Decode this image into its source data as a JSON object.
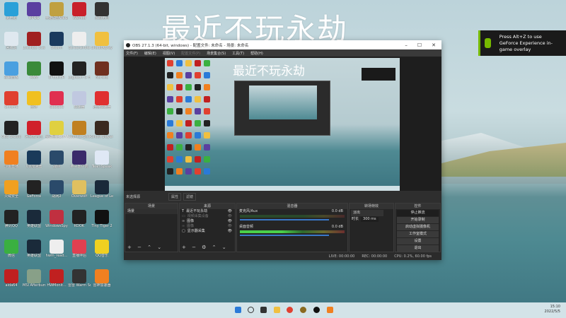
{
  "desktop": {
    "overlay_title": "最近不玩永劫",
    "icons": [
      {
        "label": "此电脑",
        "color": "#2aa0d8"
      },
      {
        "label": "OPGG",
        "color": "#5a3fa0"
      },
      {
        "label": "英雄联盟WeGame",
        "color": "#c0a040"
      },
      {
        "label": "WeMod",
        "color": "#c8202a"
      },
      {
        "label": "永劫无间",
        "color": "#333"
      },
      {
        "label": "回收站",
        "color": "#dfe8ef"
      },
      {
        "label": "Lossless Scaling",
        "color": "#a02020"
      },
      {
        "label": "Steam",
        "color": "#1b3a5e"
      },
      {
        "label": "Screenshots",
        "color": "#eee"
      },
      {
        "label": "Shadowplay",
        "color": "#f0c040"
      },
      {
        "label": "控制面板",
        "color": "#4aa0e0"
      },
      {
        "label": "RAM",
        "color": "#3a8a3a"
      },
      {
        "label": "SPEEDER",
        "color": "#111"
      },
      {
        "label": "Logitech G HUB",
        "color": "#222"
      },
      {
        "label": "Naraka",
        "color": "#703020"
      },
      {
        "label": "Chrome",
        "color": "#e04030"
      },
      {
        "label": "雷神",
        "color": "#f0c020"
      },
      {
        "label": "GeeGee",
        "color": "#e03050"
      },
      {
        "label": "加速器",
        "color": "#c0c8e0"
      },
      {
        "label": "迅游加速器",
        "color": "#e03030"
      },
      {
        "label": "OBS Studio",
        "color": "#222"
      },
      {
        "label": "网易云音乐",
        "color": "#d0202a"
      },
      {
        "label": "赛博朋克2077",
        "color": "#e0d040"
      },
      {
        "label": "Counter-Strike",
        "color": "#c08020"
      },
      {
        "label": "Ghost Slayer",
        "color": "#3a2a20"
      },
      {
        "label": "斗鱼直播",
        "color": "#f08020"
      },
      {
        "label": "UU加速器",
        "color": "#1a3a5a"
      },
      {
        "label": "战网",
        "color": "#2a4a6a"
      },
      {
        "label": "拳头客户端",
        "color": "#3a2a6a"
      },
      {
        "label": "TeamSpeak",
        "color": "#dfe8f5"
      },
      {
        "label": "火绒安全",
        "color": "#f0a020"
      },
      {
        "label": "GeForce",
        "color": "#222"
      },
      {
        "label": "战网2",
        "color": "#2a4a6a"
      },
      {
        "label": "Overwolf",
        "color": "#e0c060"
      },
      {
        "label": "League of Legends",
        "color": "#1a2a3a"
      },
      {
        "label": "腾讯QQ",
        "color": "#222"
      },
      {
        "label": "英雄联盟",
        "color": "#1a2a3a"
      },
      {
        "label": "WindowsSpy",
        "color": "#c03040"
      },
      {
        "label": "KOOK",
        "color": "#222"
      },
      {
        "label": "Tiny Tiger 2",
        "color": "#111"
      },
      {
        "label": "微信",
        "color": "#3ab040"
      },
      {
        "label": "英雄联盟",
        "color": "#1a2a3a"
      },
      {
        "label": "hwm_read...",
        "color": "#eee"
      },
      {
        "label": "直播伴侣",
        "color": "#e04050"
      },
      {
        "label": "QQ音乐",
        "color": "#f0d020"
      },
      {
        "label": "aida64",
        "color": "#c02020"
      },
      {
        "label": "MSI Afterburner",
        "color": "#88a088"
      },
      {
        "label": "HWMonit...",
        "color": "#c02020"
      },
      {
        "label": "雷雷 Warm Snow",
        "color": "#333"
      },
      {
        "label": "雷神加速器",
        "color": "#f08020"
      }
    ]
  },
  "notification": {
    "text": "Press Alt+Z to use GeForce Experience in-game overlay"
  },
  "obs": {
    "title": "OBS 27.1.3 (64-bit, windows) - 配置文件: 未命名 - 场景: 未命名",
    "controls": {
      "minimize": "–",
      "maximize": "☐",
      "close": "✕"
    },
    "menu": [
      "文件(F)",
      "编辑(E)",
      "视图(V)",
      "配置文件(P)",
      "场景集合(S)",
      "工具(T)",
      "帮助(H)"
    ],
    "preview_title": "最近不玩永劫",
    "source_bar": {
      "label": "未选择源",
      "properties": "属性",
      "filters": "滤镜"
    },
    "scenes": {
      "header": "场景",
      "items": [
        "场景"
      ]
    },
    "sources": {
      "header": "来源",
      "items": [
        "最近不玩永劫",
        "视频采集设备",
        "图像",
        "图像",
        "显示器采集"
      ]
    },
    "mixer": {
      "header": "混音器",
      "channels": [
        {
          "name": "麦克风/Aux",
          "db": "0.0 dB"
        },
        {
          "name": "桌面音频",
          "db": "0.0 dB"
        }
      ]
    },
    "transitions": {
      "header": "转场特效",
      "selected": "淡出",
      "duration_label": "时长",
      "duration": "300 ms"
    },
    "controls_dock": {
      "header": "控件",
      "buttons": [
        "停止推流",
        "开始录制",
        "启动虚拟摄像机",
        "工作室模式",
        "设置",
        "退出"
      ]
    },
    "status": {
      "live": "LIVE: 00:00:00",
      "rec": "REC: 00:00:00",
      "cpu": "CPU: 0.2%, 60.00 fps"
    }
  },
  "taskbar": {
    "time": "15:10",
    "date": "2022/5/5"
  }
}
